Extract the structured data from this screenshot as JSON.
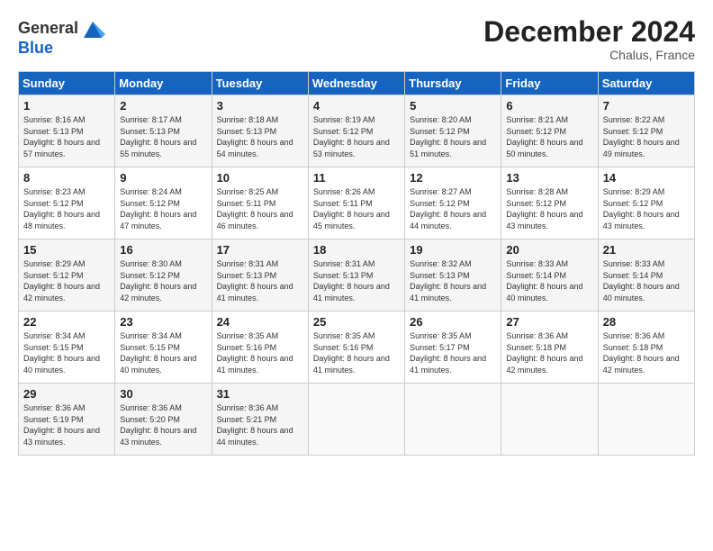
{
  "header": {
    "logo_general": "General",
    "logo_blue": "Blue",
    "month_title": "December 2024",
    "location": "Chalus, France"
  },
  "days_of_week": [
    "Sunday",
    "Monday",
    "Tuesday",
    "Wednesday",
    "Thursday",
    "Friday",
    "Saturday"
  ],
  "weeks": [
    [
      {
        "day": "1",
        "sunrise": "8:16 AM",
        "sunset": "5:13 PM",
        "daylight": "8 hours and 57 minutes."
      },
      {
        "day": "2",
        "sunrise": "8:17 AM",
        "sunset": "5:13 PM",
        "daylight": "8 hours and 55 minutes."
      },
      {
        "day": "3",
        "sunrise": "8:18 AM",
        "sunset": "5:13 PM",
        "daylight": "8 hours and 54 minutes."
      },
      {
        "day": "4",
        "sunrise": "8:19 AM",
        "sunset": "5:12 PM",
        "daylight": "8 hours and 53 minutes."
      },
      {
        "day": "5",
        "sunrise": "8:20 AM",
        "sunset": "5:12 PM",
        "daylight": "8 hours and 51 minutes."
      },
      {
        "day": "6",
        "sunrise": "8:21 AM",
        "sunset": "5:12 PM",
        "daylight": "8 hours and 50 minutes."
      },
      {
        "day": "7",
        "sunrise": "8:22 AM",
        "sunset": "5:12 PM",
        "daylight": "8 hours and 49 minutes."
      }
    ],
    [
      {
        "day": "8",
        "sunrise": "8:23 AM",
        "sunset": "5:12 PM",
        "daylight": "8 hours and 48 minutes."
      },
      {
        "day": "9",
        "sunrise": "8:24 AM",
        "sunset": "5:12 PM",
        "daylight": "8 hours and 47 minutes."
      },
      {
        "day": "10",
        "sunrise": "8:25 AM",
        "sunset": "5:11 PM",
        "daylight": "8 hours and 46 minutes."
      },
      {
        "day": "11",
        "sunrise": "8:26 AM",
        "sunset": "5:11 PM",
        "daylight": "8 hours and 45 minutes."
      },
      {
        "day": "12",
        "sunrise": "8:27 AM",
        "sunset": "5:12 PM",
        "daylight": "8 hours and 44 minutes."
      },
      {
        "day": "13",
        "sunrise": "8:28 AM",
        "sunset": "5:12 PM",
        "daylight": "8 hours and 43 minutes."
      },
      {
        "day": "14",
        "sunrise": "8:29 AM",
        "sunset": "5:12 PM",
        "daylight": "8 hours and 43 minutes."
      }
    ],
    [
      {
        "day": "15",
        "sunrise": "8:29 AM",
        "sunset": "5:12 PM",
        "daylight": "8 hours and 42 minutes."
      },
      {
        "day": "16",
        "sunrise": "8:30 AM",
        "sunset": "5:12 PM",
        "daylight": "8 hours and 42 minutes."
      },
      {
        "day": "17",
        "sunrise": "8:31 AM",
        "sunset": "5:13 PM",
        "daylight": "8 hours and 41 minutes."
      },
      {
        "day": "18",
        "sunrise": "8:31 AM",
        "sunset": "5:13 PM",
        "daylight": "8 hours and 41 minutes."
      },
      {
        "day": "19",
        "sunrise": "8:32 AM",
        "sunset": "5:13 PM",
        "daylight": "8 hours and 41 minutes."
      },
      {
        "day": "20",
        "sunrise": "8:33 AM",
        "sunset": "5:14 PM",
        "daylight": "8 hours and 40 minutes."
      },
      {
        "day": "21",
        "sunrise": "8:33 AM",
        "sunset": "5:14 PM",
        "daylight": "8 hours and 40 minutes."
      }
    ],
    [
      {
        "day": "22",
        "sunrise": "8:34 AM",
        "sunset": "5:15 PM",
        "daylight": "8 hours and 40 minutes."
      },
      {
        "day": "23",
        "sunrise": "8:34 AM",
        "sunset": "5:15 PM",
        "daylight": "8 hours and 40 minutes."
      },
      {
        "day": "24",
        "sunrise": "8:35 AM",
        "sunset": "5:16 PM",
        "daylight": "8 hours and 41 minutes."
      },
      {
        "day": "25",
        "sunrise": "8:35 AM",
        "sunset": "5:16 PM",
        "daylight": "8 hours and 41 minutes."
      },
      {
        "day": "26",
        "sunrise": "8:35 AM",
        "sunset": "5:17 PM",
        "daylight": "8 hours and 41 minutes."
      },
      {
        "day": "27",
        "sunrise": "8:36 AM",
        "sunset": "5:18 PM",
        "daylight": "8 hours and 42 minutes."
      },
      {
        "day": "28",
        "sunrise": "8:36 AM",
        "sunset": "5:18 PM",
        "daylight": "8 hours and 42 minutes."
      }
    ],
    [
      {
        "day": "29",
        "sunrise": "8:36 AM",
        "sunset": "5:19 PM",
        "daylight": "8 hours and 43 minutes."
      },
      {
        "day": "30",
        "sunrise": "8:36 AM",
        "sunset": "5:20 PM",
        "daylight": "8 hours and 43 minutes."
      },
      {
        "day": "31",
        "sunrise": "8:36 AM",
        "sunset": "5:21 PM",
        "daylight": "8 hours and 44 minutes."
      },
      null,
      null,
      null,
      null
    ]
  ]
}
